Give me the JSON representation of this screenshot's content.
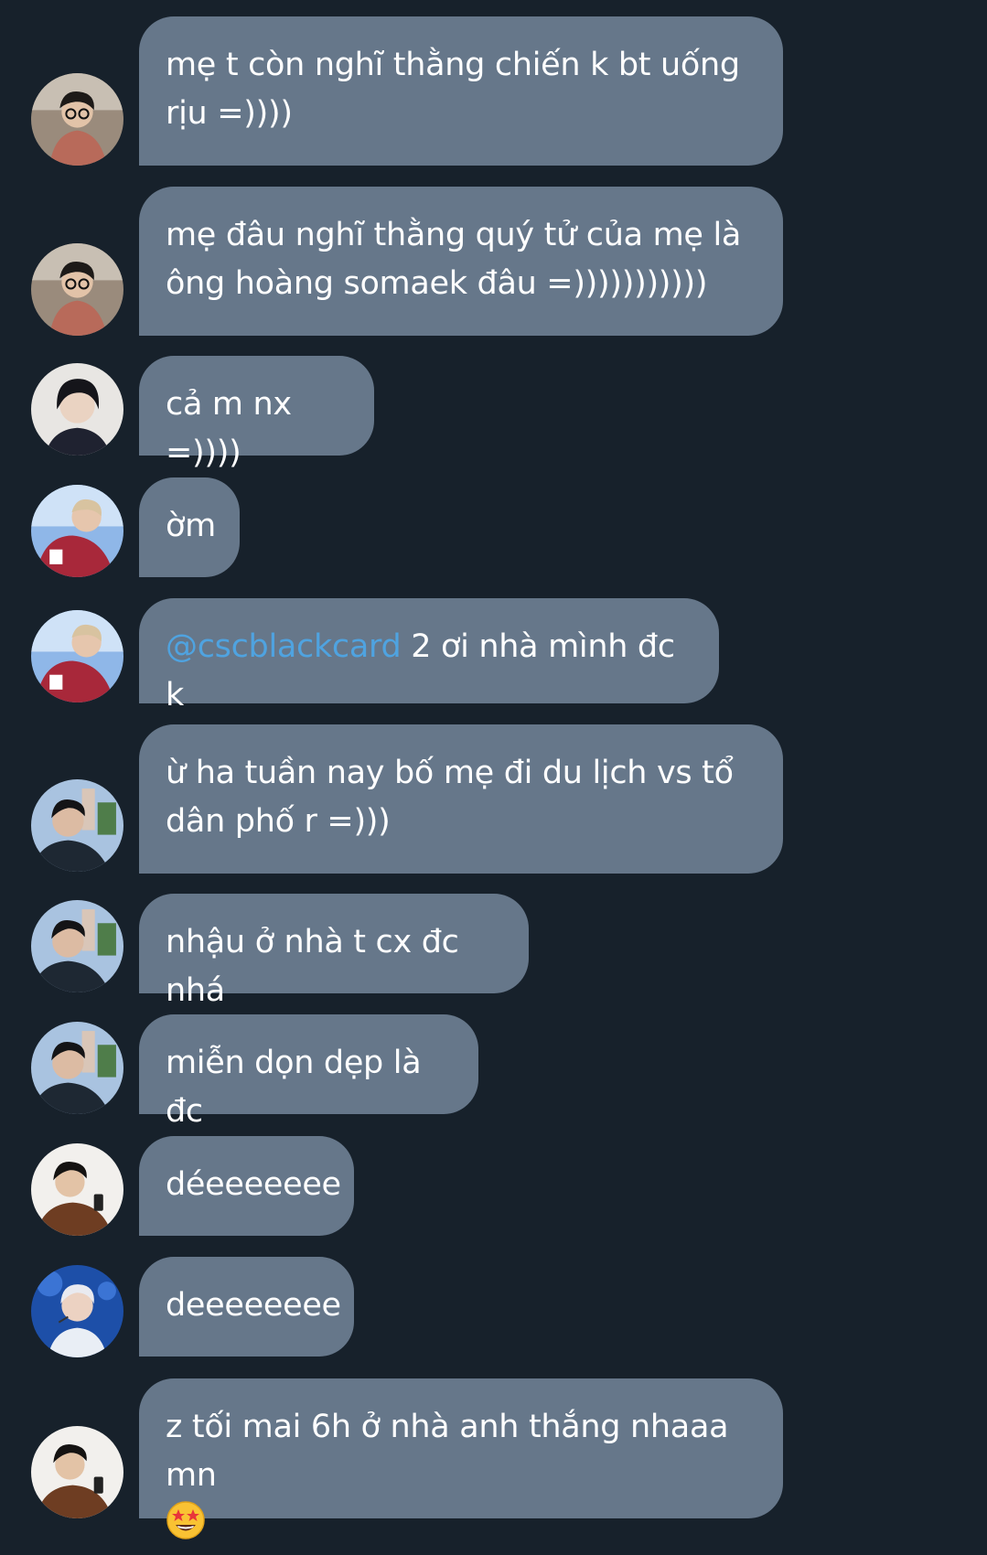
{
  "messages": [
    {
      "avatar": "avatar-glasses-boy",
      "text": "mẹ t còn nghĩ thằng chiến k bt uống rịu =))))"
    },
    {
      "avatar": "avatar-glasses-boy",
      "text": "mẹ đâu nghĩ thằng quý tử của mẹ là ông hoàng somaek đâu =)))))))))))"
    },
    {
      "avatar": "avatar-dark-hair",
      "text": "cả m nx =))))"
    },
    {
      "avatar": "avatar-red-shirt",
      "text": "ờm"
    },
    {
      "avatar": "avatar-red-shirt",
      "mention": "@cscblackcard",
      "text": " 2 ơi nhà mình đc k"
    },
    {
      "avatar": "avatar-city-boy",
      "text": "ừ ha tuần nay bố mẹ đi du lịch vs tổ dân phố r =)))"
    },
    {
      "avatar": "avatar-city-boy",
      "text": "nhậu ở nhà t cx đc nhá"
    },
    {
      "avatar": "avatar-city-boy",
      "text": "miễn dọn dẹp là đc"
    },
    {
      "avatar": "avatar-phone-boy",
      "text": "déeeeeeee"
    },
    {
      "avatar": "avatar-stage-boy",
      "text": "deeeeeeee"
    },
    {
      "avatar": "avatar-phone-boy",
      "text": "z tối mai 6h ở nhà anh thắng nhaaa mn",
      "emoji": "star-struck-emoji"
    }
  ],
  "colors": {
    "background": "#17212b",
    "bubble": "#66778a",
    "text": "#ffffff",
    "mention": "#4fa3e0"
  }
}
